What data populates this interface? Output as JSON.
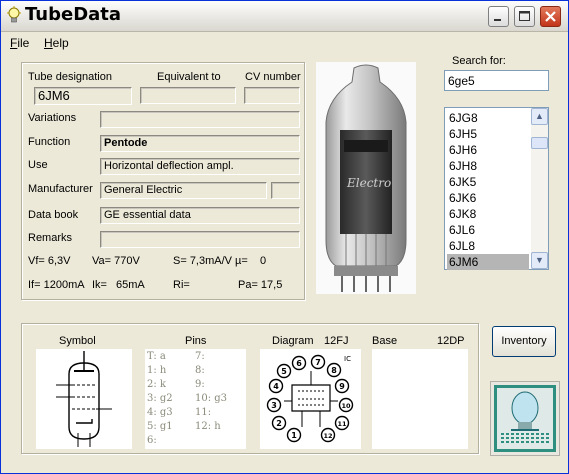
{
  "window": {
    "title": "TubeData"
  },
  "menu": [
    {
      "prefix": "",
      "ul": "F",
      "rest": "ile"
    },
    {
      "prefix": "",
      "ul": "H",
      "rest": "elp"
    }
  ],
  "fields": {
    "tube_designation_label": "Tube designation",
    "equivalent_to_label": "Equivalent to",
    "cv_number_label": "CV number",
    "tube_designation": "6JM6",
    "equivalent_to": "",
    "cv_number": "",
    "variations_label": "Variations",
    "variations": "",
    "function_label": "Function",
    "function": "Pentode",
    "use_label": "Use",
    "use": "Horizontal deflection ampl.",
    "manufacturer_label": "Manufacturer",
    "manufacturer": "General Electric",
    "manufacturer_extra": "",
    "data_book_label": "Data book",
    "data_book": "GE essential data",
    "remarks_label": "Remarks",
    "remarks": ""
  },
  "specs": {
    "vf": "Vf= 6,3V",
    "va": "Va= 770V",
    "s": "S= 7,3mA/V",
    "mu": "µ=",
    "mu_val": "0",
    "if": "If= 1200mA",
    "ik": "Ik=",
    "ik_val": "65mA",
    "ri": "Ri=",
    "pa": "Pa= 17,5"
  },
  "search": {
    "label": "Search for:",
    "value": "6ge5"
  },
  "tube_list": [
    "6JG8",
    "6JH5",
    "6JH6",
    "6JH8",
    "6JK5",
    "6JK6",
    "6JK8",
    "6JL6",
    "6JL8",
    "6JM6"
  ],
  "selected_tube": "6JM6",
  "photo": {
    "label": "Electro"
  },
  "bottom": {
    "symbol_label": "Symbol",
    "pins_label": "Pins",
    "diagram_label": "Diagram",
    "diagram_code": "12FJ",
    "base_label": "Base",
    "base_code": "12DP",
    "pins_col1": [
      "T: a",
      "1: h",
      "2: k",
      "3: g2",
      "4: g3",
      "5: g1",
      "6:"
    ],
    "pins_col2": [
      "7:",
      "8:",
      "9:",
      "10: g3",
      "11:",
      "12: h"
    ],
    "diagram_pins": [
      "1",
      "2",
      "3",
      "4",
      "5",
      "6",
      "7",
      "8",
      "9",
      "10",
      "11",
      "12"
    ],
    "diagram_ic": "IC"
  },
  "inventory_button": "Inventory",
  "colors": {
    "title_bar": "#d9d7cf",
    "window_bg": "#ece9d8",
    "close_button": "#c2341a",
    "selection": "#b5b5b5"
  }
}
